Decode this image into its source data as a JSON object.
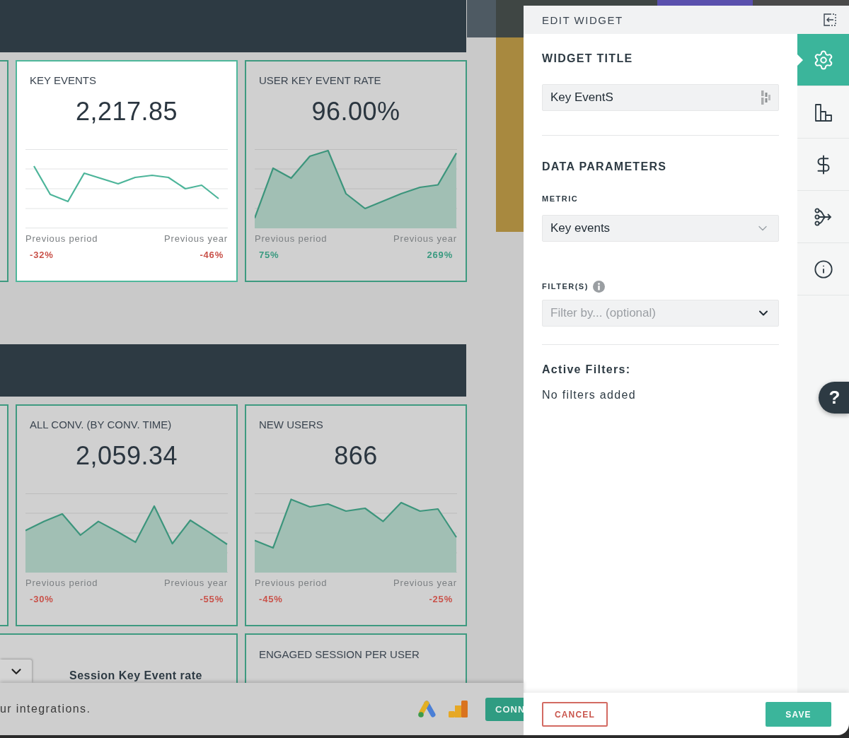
{
  "dashboard": {
    "widget_rows": [
      {
        "widgets": [
          {
            "title": "KEY EVENTS",
            "value": "2,217.85",
            "selected": true,
            "kind": "line",
            "comparisons": [
              {
                "label": "Previous period",
                "change": "-32%",
                "color": "#c9524a"
              },
              {
                "label": "Previous year",
                "change": "-46%",
                "color": "#c9524a"
              }
            ]
          },
          {
            "title": "USER KEY EVENT RATE",
            "value": "96.00%",
            "selected": false,
            "kind": "area",
            "comparisons": [
              {
                "label": "Previous period",
                "change": "75%",
                "color": "#3a9a80"
              },
              {
                "label": "Previous year",
                "change": "269%",
                "color": "#3a9a80"
              }
            ]
          }
        ]
      },
      {
        "widgets": [
          {
            "title": "ALL CONV. (BY CONV. TIME)",
            "value": "2,059.34",
            "selected": false,
            "kind": "area",
            "comparisons": [
              {
                "label": "Previous period",
                "change": "-30%",
                "color": "#c9524a"
              },
              {
                "label": "Previous year",
                "change": "-55%",
                "color": "#c9524a"
              }
            ]
          },
          {
            "title": "NEW USERS",
            "value": "866",
            "selected": false,
            "kind": "area",
            "comparisons": [
              {
                "label": "Previous period",
                "change": "-45%",
                "color": "#c9524a"
              },
              {
                "label": "Previous year",
                "change": "-25%",
                "color": "#c9524a"
              }
            ]
          }
        ]
      }
    ],
    "lower_widgets": [
      {
        "title": "Session Key Event rate",
        "kind": "table",
        "selected": false
      },
      {
        "title": "ENGAGED SESSION PER USER",
        "kind": "kpi",
        "selected": false
      }
    ]
  },
  "integrations_bar": {
    "text": "ur integrations.",
    "button": "CONN"
  },
  "edit_panel": {
    "title": "EDIT WIDGET",
    "widget_title": {
      "heading": "WIDGET TITLE",
      "value": "Key EventS"
    },
    "data_parameters": {
      "heading": "DATA PARAMETERS",
      "metric": {
        "label": "METRIC",
        "value": "Key events"
      },
      "filters": {
        "label": "FILTER(S)",
        "placeholder": "Filter by... (optional)"
      }
    },
    "active_filters": {
      "heading": "Active Filters:",
      "text": "No filters added"
    },
    "rail_tabs": [
      {
        "kind": "settings",
        "selected": true
      },
      {
        "kind": "chart",
        "selected": false
      },
      {
        "kind": "currency",
        "selected": false
      },
      {
        "kind": "flow",
        "selected": false
      },
      {
        "kind": "info",
        "selected": false
      }
    ],
    "help_button": "?",
    "buttons": [
      {
        "kind": "cancel",
        "label": "CANCEL"
      },
      {
        "kind": "save",
        "label": "SAVE"
      }
    ]
  }
}
